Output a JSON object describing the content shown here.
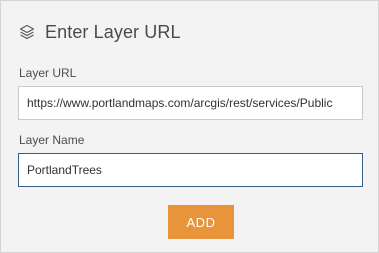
{
  "header": {
    "icon": "layers-icon",
    "title": "Enter Layer URL"
  },
  "form": {
    "url_label": "Layer URL",
    "url_value": "https://www.portlandmaps.com/arcgis/rest/services/Public",
    "name_label": "Layer Name",
    "name_value": "PortlandTrees",
    "add_label": "ADD"
  },
  "colors": {
    "panel_background": "#f3f3f3",
    "accent_button": "#e8943b",
    "focused_field_border": "#3a5d8a"
  }
}
